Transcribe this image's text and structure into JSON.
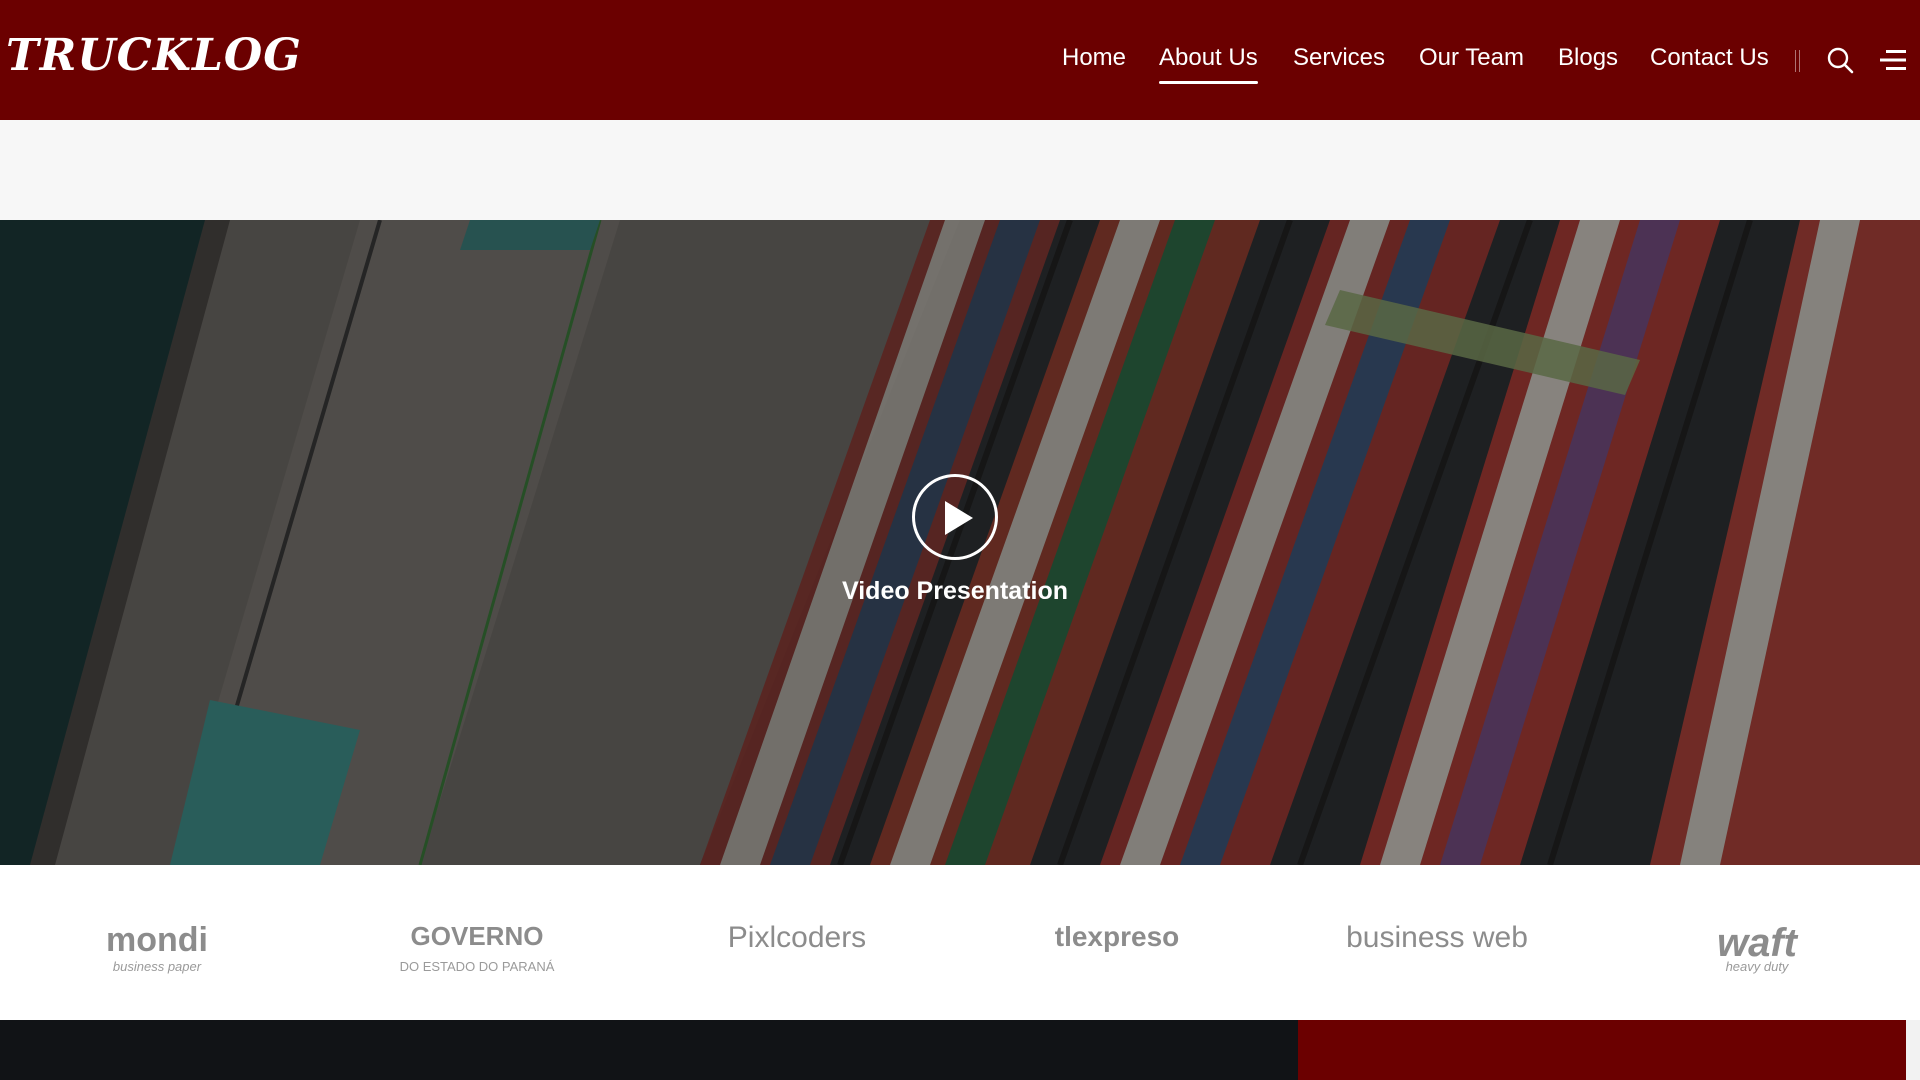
{
  "header": {
    "logo_text": "TRUCKLOG",
    "nav": [
      {
        "label": "Home"
      },
      {
        "label": "About Us"
      },
      {
        "label": "Services"
      },
      {
        "label": "Our Team"
      },
      {
        "label": "Blogs"
      },
      {
        "label": "Contact Us"
      }
    ],
    "active_nav": "About Us",
    "icons": [
      "search-icon",
      "menu-icon"
    ]
  },
  "video": {
    "label": "Video Presentation",
    "icon": "play-icon"
  },
  "partners": [
    {
      "name": "mondi",
      "tagline": "business paper"
    },
    {
      "name": "GOVERNO",
      "tagline": "DO ESTADO DO PARANÁ"
    },
    {
      "name": "Pixlcoders",
      "tagline": ""
    },
    {
      "name": "tlexpreso",
      "tagline": ""
    },
    {
      "name": "business web",
      "tagline": ""
    },
    {
      "name": "waft",
      "tagline": "heavy duty"
    }
  ],
  "colors": {
    "brand": "#6b0000",
    "footer_dark": "#111316",
    "partner_gray": "#8c8c8c"
  }
}
